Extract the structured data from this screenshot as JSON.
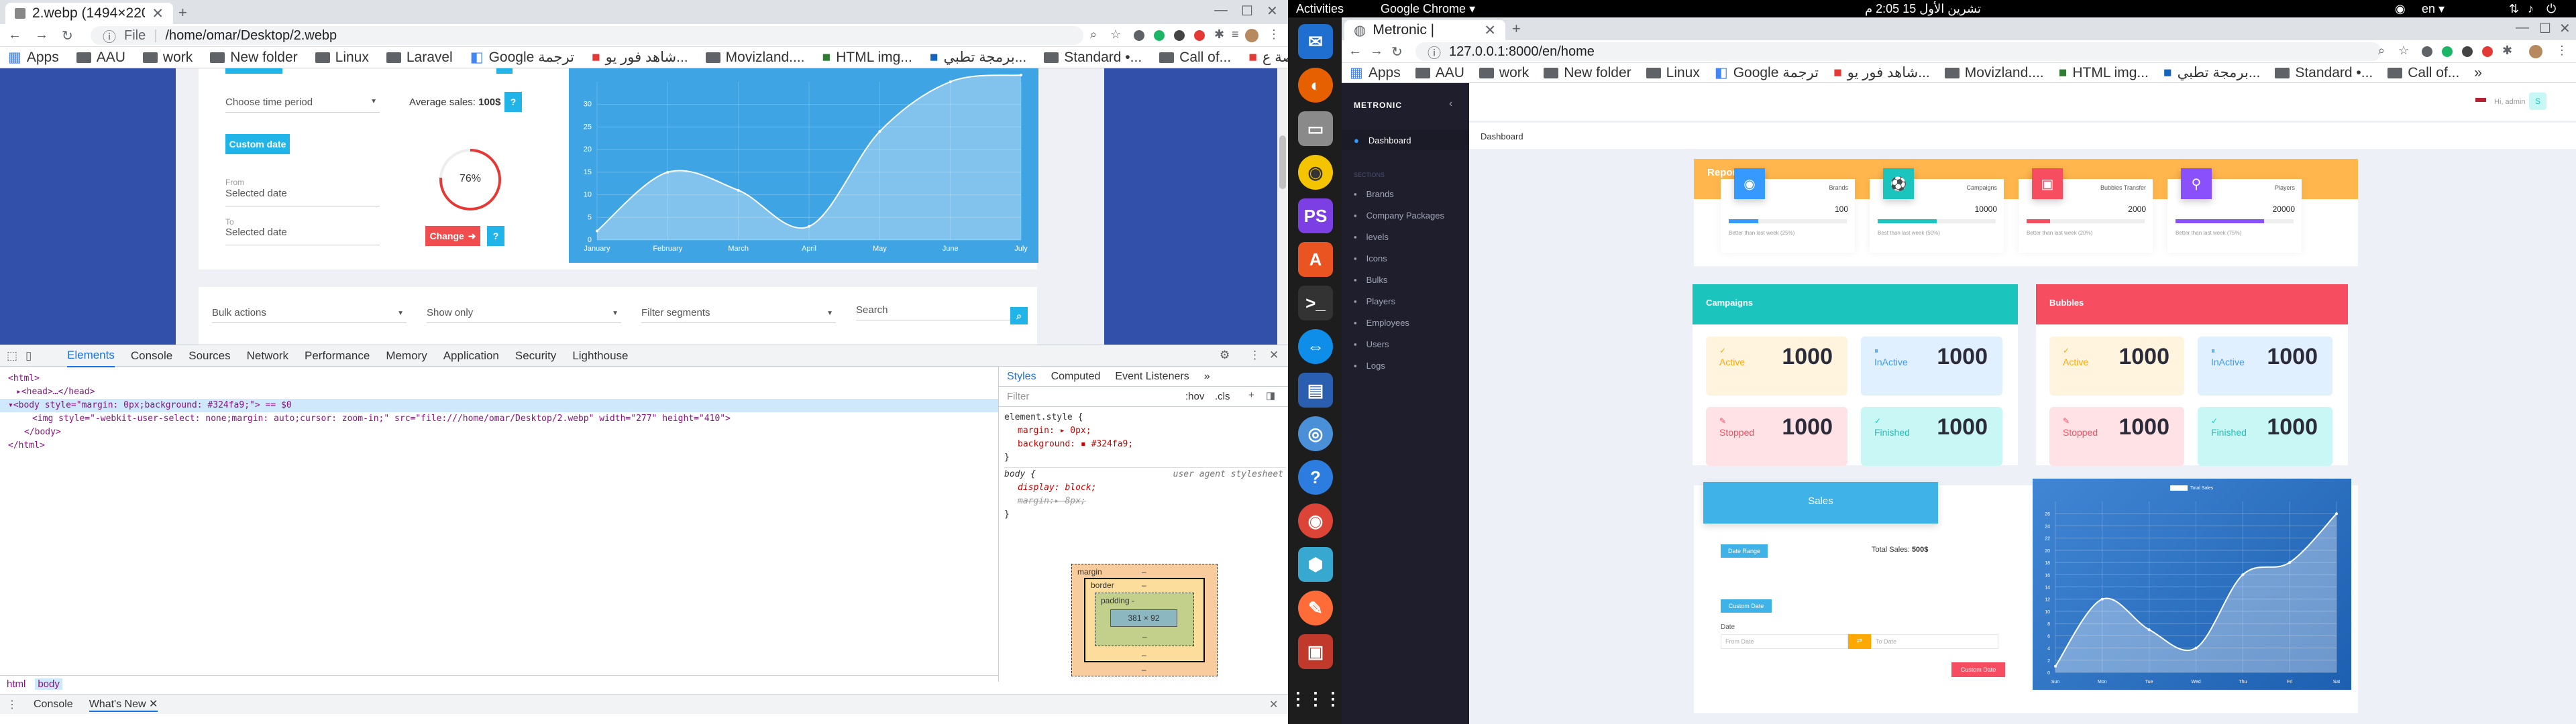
{
  "left_browser": {
    "tab_title": "2.webp (1494×2204)",
    "file_label": "File",
    "url": "/home/omar/Desktop/2.webp",
    "bookmarks": [
      {
        "label": "Apps"
      },
      {
        "label": "AAU"
      },
      {
        "label": "work"
      },
      {
        "label": "New folder"
      },
      {
        "label": "Linux"
      },
      {
        "label": "Laravel"
      },
      {
        "label": "Google ترجمة"
      },
      {
        "label": "شاهد فور يو..."
      },
      {
        "label": "Movizland...."
      },
      {
        "label": "HTML img..."
      },
      {
        "label": "برمجة تطبي..."
      },
      {
        "label": "Standard •..."
      },
      {
        "label": "Call of..."
      },
      {
        "label": "موقع قصة ع..."
      },
      {
        "label": "»"
      }
    ],
    "page": {
      "choose_period": "Choose time period",
      "average_sales_label": "Average sales:",
      "average_sales_value": "100$",
      "help_mark": "?",
      "custom_date": "Custom date",
      "from_label": "From",
      "from_value": "Selected date",
      "to_label": "To",
      "to_value": "Selected date",
      "gauge_value": "76%",
      "change_button": "Change",
      "bulk_actions": "Bulk actions",
      "show_only": "Show only",
      "filter_segments": "Filter segments",
      "search_placeholder": "Search"
    },
    "chart_data": {
      "type": "area",
      "categories": [
        "January",
        "February",
        "March",
        "April",
        "May",
        "June",
        "July"
      ],
      "values": [
        2,
        15,
        11,
        3,
        24,
        35,
        40
      ],
      "ylim": [
        0,
        35
      ],
      "yticks": [
        "0",
        "5",
        "10",
        "15",
        "20",
        "25",
        "30"
      ],
      "grid": true
    },
    "devtools": {
      "tabs": [
        "Elements",
        "Console",
        "Sources",
        "Network",
        "Performance",
        "Memory",
        "Application",
        "Security",
        "Lighthouse"
      ],
      "code_lines": [
        "<html>",
        "▸<head>…</head>",
        "▾<body style=\"margin: 0px;background: #324fa9;\"> == $0",
        "<img style=\"-webkit-user-select: none;margin: auto;cursor: zoom-in;\" src=\"file:///home/omar/Desktop/2.webp\" width=\"277\" height=\"410\">",
        "</body>",
        "</html>"
      ],
      "style_tabs": [
        "Styles",
        "Computed",
        "Event Listeners",
        "»"
      ],
      "filter_placeholder": "Filter",
      "hov": ":hov",
      "cls": ".cls",
      "rule1_selector": "element.style {",
      "rule1_prop1": "margin: ▸ 0px;",
      "rule1_prop2": "background: ▪ #324fa9;",
      "rule_close": "}",
      "rule2_selector": "body {",
      "rule2_source": "user agent stylesheet",
      "rule2_prop1": "display: block;",
      "rule2_prop2": "margin:▸ 8px;",
      "box_margin": "margin",
      "box_border": "border",
      "box_padding": "padding -",
      "box_dash": "–",
      "box_content": "381 × 92",
      "breadcrumbs": [
        "html",
        "body"
      ],
      "drawer_tabs": [
        "Console",
        "What's New"
      ]
    }
  },
  "ubuntu": {
    "activities": "Activities",
    "app_name": "Google Chrome ▾",
    "clock": "تشرين الأول 15  2:05 م",
    "lang": "en ▾"
  },
  "right_browser": {
    "tab_title": "Metronic |",
    "url": "127.0.0.1:8000/en/home",
    "bookmarks": [
      {
        "label": "Apps"
      },
      {
        "label": "AAU"
      },
      {
        "label": "work"
      },
      {
        "label": "New folder"
      },
      {
        "label": "Linux"
      },
      {
        "label": "Google ترجمة"
      },
      {
        "label": "شاهد فور يو..."
      },
      {
        "label": "Movizland...."
      },
      {
        "label": "HTML img..."
      },
      {
        "label": "برمجة تطبي..."
      },
      {
        "label": "Standard •..."
      },
      {
        "label": "Call of..."
      },
      {
        "label": "»"
      }
    ],
    "app": {
      "brand": "METRONIC",
      "user_greeting": "Hi, admin",
      "breadcrumb": "Dashboard",
      "sidebar_active": "Dashboard",
      "sidebar_section": "SECTIONS",
      "sidebar_items": [
        "Brands",
        "Company Packages",
        "levels",
        "Icons",
        "Bulks",
        "Players",
        "Employees",
        "Users",
        "Logs"
      ],
      "reports_title": "Reports",
      "report_cards": [
        {
          "label": "Brands",
          "value": "100",
          "note": "Better than last week (25%)",
          "color": "#3699ff"
        },
        {
          "label": "Campaigns",
          "value": "10000",
          "note": "Best than last week (50%)",
          "color": "#1bc5bd"
        },
        {
          "label": "Bubbles Transfer",
          "value": "2000",
          "note": "Better than last week (20%)",
          "color": "#f64e60"
        },
        {
          "label": "Players",
          "value": "20000",
          "note": "Better than last week (75%)",
          "color": "#8950fc"
        }
      ],
      "campaigns_title": "Campaigns",
      "bubbles_title": "Bubbles",
      "status_tiles": [
        {
          "label": "Active",
          "value": "1000"
        },
        {
          "label": "InActive",
          "value": "1000"
        },
        {
          "label": "Stopped",
          "value": "1000"
        },
        {
          "label": "Finished",
          "value": "1000"
        }
      ],
      "sales_title": "Sales",
      "date_range_button": "Date Range",
      "total_sales_label": "Total Sales:",
      "total_sales_value": "500$",
      "custom_date_button": "Custom Date",
      "date_label": "Date",
      "from_date_placeholder": "From Date",
      "to_date_placeholder": "To Date",
      "custom_date2_button": "Custom Date",
      "chart_legend": "Total Sales",
      "chart_data": {
        "type": "area",
        "categories": [
          "Sun",
          "Mon",
          "Tue",
          "Wed",
          "Thu",
          "Fri",
          "Sat"
        ],
        "values": [
          1,
          12,
          7,
          4,
          16,
          18,
          26
        ],
        "ylim": [
          0,
          28
        ],
        "yticks": [
          "0",
          "2",
          "4",
          "6",
          "8",
          "10",
          "12",
          "14",
          "16",
          "18",
          "20",
          "22",
          "24",
          "26"
        ],
        "grid": true
      }
    }
  }
}
